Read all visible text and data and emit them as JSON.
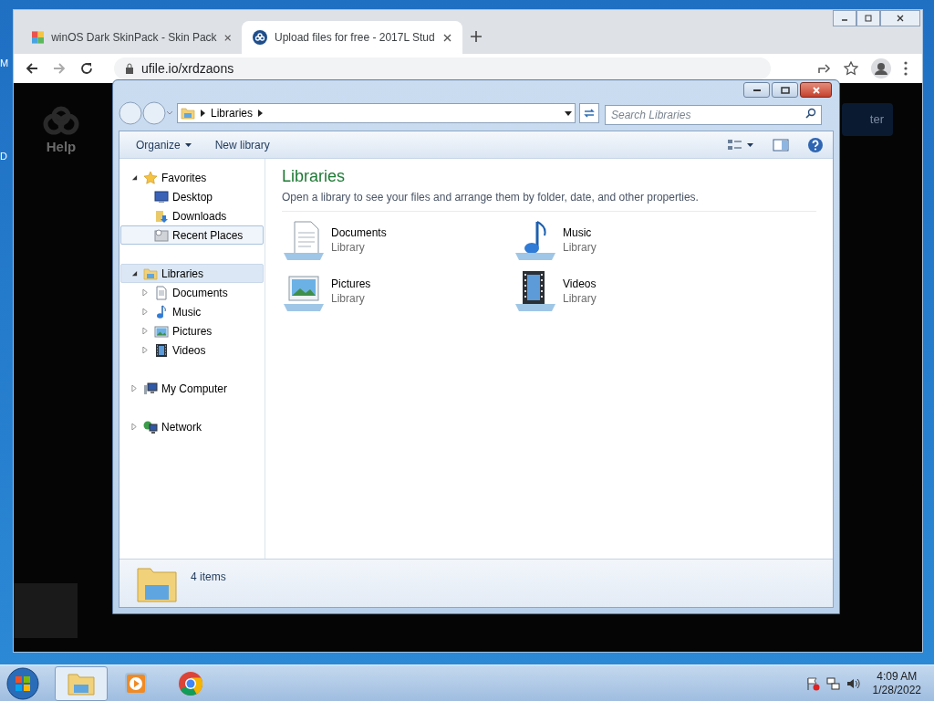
{
  "desktop": {
    "icon_labels": [
      "M",
      "D"
    ]
  },
  "browser": {
    "tabs": [
      {
        "title": "winOS Dark SkinPack - Skin Pack",
        "selected": false,
        "kind": "skinpack"
      },
      {
        "title": "Upload files for free - 2017L Stud",
        "selected": true,
        "kind": "ufile"
      }
    ],
    "address": "ufile.io/xrdzaons",
    "page": {
      "help_label": "Help",
      "button_label": "ter"
    }
  },
  "explorer": {
    "breadcrumb": [
      "Libraries"
    ],
    "search": {
      "placeholder": "Search Libraries"
    },
    "toolbar": [
      {
        "label": "Organize",
        "dropdown": true
      },
      {
        "label": "New library",
        "dropdown": false
      }
    ],
    "navigation": [
      {
        "label": "Favorites",
        "kind": "star",
        "expanded": true,
        "selected": false,
        "hovered": false,
        "children": [
          {
            "label": "Desktop",
            "kind": "desktop",
            "selected": false,
            "hovered": false
          },
          {
            "label": "Downloads",
            "kind": "downloads",
            "selected": false,
            "hovered": false
          },
          {
            "label": "Recent Places",
            "kind": "recent",
            "selected": false,
            "hovered": true
          }
        ]
      },
      {
        "label": "Libraries",
        "kind": "library",
        "expanded": true,
        "selected": true,
        "hovered": false,
        "children": [
          {
            "label": "Documents",
            "kind": "document",
            "expanded": false,
            "selected": false,
            "hovered": false
          },
          {
            "label": "Music",
            "kind": "music",
            "expanded": false,
            "selected": false,
            "hovered": false
          },
          {
            "label": "Pictures",
            "kind": "pictures",
            "expanded": false,
            "selected": false,
            "hovered": false
          },
          {
            "label": "Videos",
            "kind": "videos",
            "expanded": false,
            "selected": false,
            "hovered": false
          }
        ]
      },
      {
        "label": "My Computer",
        "kind": "computer",
        "expanded": false,
        "selected": false,
        "hovered": false
      },
      {
        "label": "Network",
        "kind": "network",
        "expanded": false,
        "selected": false,
        "hovered": false
      }
    ],
    "heading": "Libraries",
    "description": "Open a library to see your files and arrange them by folder, date, and other properties.",
    "items": [
      {
        "name": "Documents",
        "subtitle": "Library",
        "kind": "document"
      },
      {
        "name": "Music",
        "subtitle": "Library",
        "kind": "music"
      },
      {
        "name": "Pictures",
        "subtitle": "Library",
        "kind": "pictures"
      },
      {
        "name": "Videos",
        "subtitle": "Library",
        "kind": "videos"
      }
    ],
    "status": "4 items"
  },
  "taskbar": {
    "apps": [
      {
        "kind": "explorer",
        "active": true
      },
      {
        "kind": "media",
        "active": false
      },
      {
        "kind": "chrome",
        "active": false
      }
    ],
    "time": "4:09 AM",
    "date": "1/28/2022"
  }
}
